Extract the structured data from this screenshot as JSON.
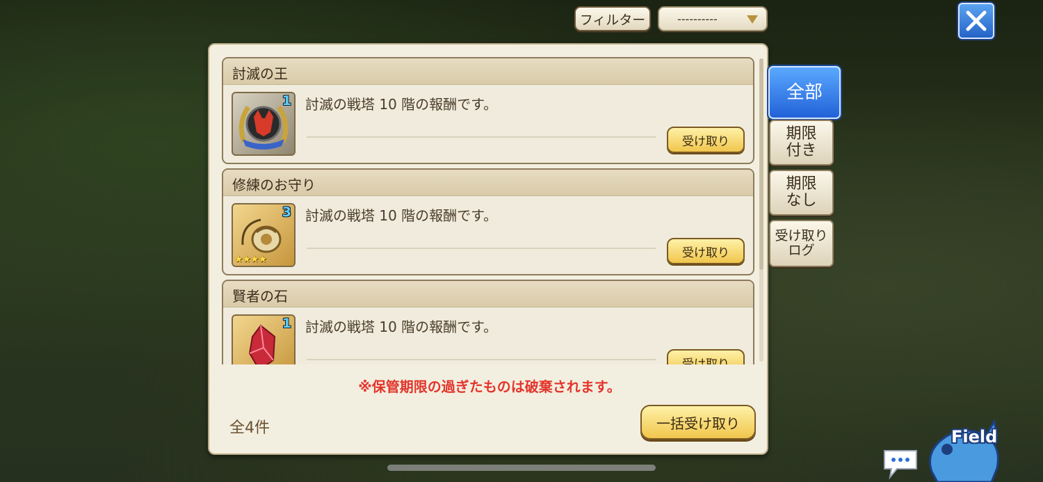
{
  "top_bar": {
    "filter_label": "フィルター",
    "filter_value": "----------"
  },
  "rewards": [
    {
      "name": "討滅の王",
      "description": "討滅の戦塔 10 階の報酬です。",
      "quantity": "1",
      "stars": "",
      "claim_label": "受け取り",
      "icon": "fox-mask-emblem-icon"
    },
    {
      "name": "修練のお守り",
      "description": "討滅の戦塔 10 階の報酬です。",
      "quantity": "3",
      "stars": "★★★★",
      "claim_label": "受け取り",
      "icon": "amulet-pouch-icon"
    },
    {
      "name": "賢者の石",
      "description": "討滅の戦塔 10 階の報酬です。",
      "quantity": "1",
      "stars": "",
      "claim_label": "受け取り",
      "icon": "red-crystal-icon"
    }
  ],
  "panel": {
    "warning": "※保管期限の過ぎたものは破棄されます。",
    "total": "全4件",
    "bulk_claim_label": "一括受け取り"
  },
  "tabs": {
    "all": "全部",
    "with_deadline": "期限\n付き",
    "no_deadline": "期限\nなし",
    "claim_log": "受け取り\nログ"
  },
  "field": {
    "label": "Field"
  },
  "colors": {
    "accent_blue": "#2c6ee0",
    "warning_red": "#e3352c",
    "button_gold": "#f0c64c"
  }
}
